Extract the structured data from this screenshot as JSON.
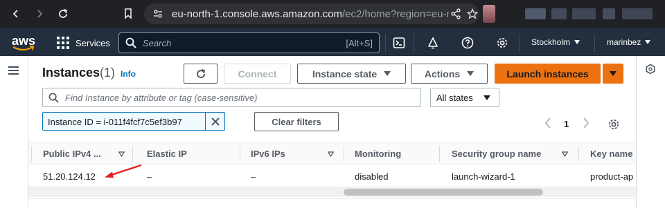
{
  "browser": {
    "url_host": "eu-north-1.console.aws.amazon.com",
    "url_rest": "/ec2/home?region=eu-n..."
  },
  "aws_nav": {
    "logo_text": "aws",
    "services_label": "Services",
    "search_placeholder": "Search",
    "search_shortcut": "[Alt+S]",
    "region_label": "Stockholm",
    "user_label": "marinbez"
  },
  "header": {
    "title": "Instances",
    "count": "(1)",
    "info_link": "Info",
    "buttons": {
      "connect": "Connect",
      "instance_state": "Instance state",
      "actions": "Actions",
      "launch": "Launch instances"
    }
  },
  "filter": {
    "search_placeholder": "Find Instance by attribute or tag (case-sensitive)",
    "states_value": "All states",
    "token_text": "Instance ID = i-011f4fcf7c5ef3b97",
    "clear_filters": "Clear filters"
  },
  "pagination": {
    "current_page": "1"
  },
  "table": {
    "columns": [
      "Public IPv4 ...",
      "Elastic IP",
      "IPv6 IPs",
      "Monitoring",
      "Security group name",
      "Key name"
    ],
    "rows": [
      [
        "51.20.124.12",
        "–",
        "–",
        "disabled",
        "launch-wizard-1",
        "product-ap"
      ]
    ]
  },
  "colors": {
    "aws_nav_bg": "#232f3e",
    "primary_button": "#ec7211",
    "link_blue": "#0073bb",
    "annotation_arrow": "#e02020"
  },
  "annotations": {
    "arrow": "red-arrow-pointing-at-public-ip"
  }
}
